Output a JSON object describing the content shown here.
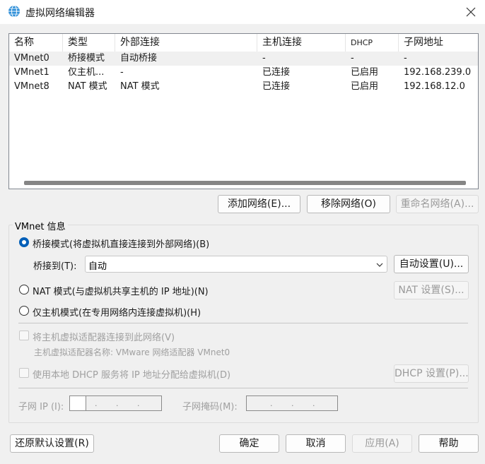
{
  "window": {
    "title": "虚拟网络编辑器",
    "close_icon": "close-icon",
    "app_icon": "vmware-globe-icon"
  },
  "network_table": {
    "columns": [
      "名称",
      "类型",
      "外部连接",
      "主机连接",
      "DHCP",
      "子网地址"
    ],
    "rows": [
      [
        "VMnet0",
        "桥接模式",
        "自动桥接",
        "-",
        "-",
        "-"
      ],
      [
        "VMnet1",
        "仅主机...",
        "-",
        "已连接",
        "已启用",
        "192.168.239.0"
      ],
      [
        "VMnet8",
        "NAT 模式",
        "NAT 模式",
        "已连接",
        "已启用",
        "192.168.12.0"
      ]
    ],
    "selected_row": 0
  },
  "table_buttons": {
    "add": "添加网络(E)...",
    "remove": "移除网络(O)",
    "rename": "重命名网络(A)..."
  },
  "vmnet_info": {
    "group_label": "VMnet 信息",
    "bridged_radio": "桥接模式(将虚拟机直接连接到外部网络)(B)",
    "bridge_to_label": "桥接到(T):",
    "bridge_to_value": "自动",
    "auto_settings": "自动设置(U)...",
    "nat_radio": "NAT 模式(与虚拟机共享主机的 IP 地址)(N)",
    "nat_settings": "NAT 设置(S)...",
    "hostonly_radio": "仅主机模式(在专用网络内连接虚拟机)(H)",
    "connect_adapter": "将主机虚拟适配器连接到此网络(V)",
    "adapter_name": "主机虚拟适配器名称: VMware 网络适配器 VMnet0",
    "use_dhcp": "使用本地 DHCP 服务将 IP 地址分配给虚拟机(D)",
    "dhcp_settings": "DHCP 设置(P)...",
    "subnet_ip_label": "子网 IP (I):",
    "subnet_mask_label": "子网掩码(M):",
    "ip_dot": "."
  },
  "footer": {
    "restore": "还原默认设置(R)",
    "ok": "确定",
    "cancel": "取消",
    "apply": "应用(A)",
    "help": "帮助"
  }
}
